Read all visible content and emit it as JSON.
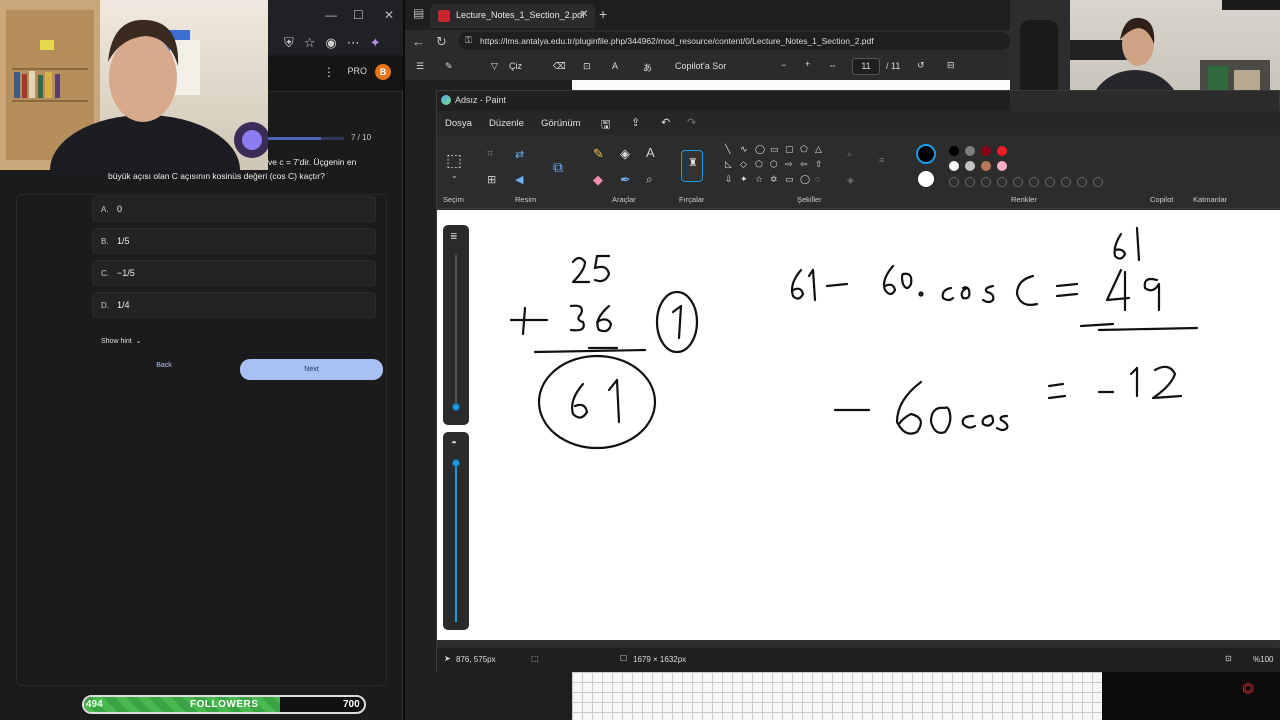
{
  "quiz": {
    "progress_text": "7 / 10",
    "progress_fraction": 0.7,
    "question_line1": "ve c = 7'dir. Üçgenin en",
    "question_line2": "büyük açısı olan C açısının kosinüs değeri (cos C) kaçtır?",
    "options": [
      {
        "letter": "A.",
        "value": "0"
      },
      {
        "letter": "B.",
        "value": "1/5"
      },
      {
        "letter": "C.",
        "value": "−1/5"
      },
      {
        "letter": "D.",
        "value": "1/4"
      }
    ],
    "show_hint": "Show hint",
    "back": "Back",
    "next": "Next",
    "pro": "PRO",
    "avatar_letter": "B"
  },
  "followers": {
    "current": "494",
    "label": "FOLLOWERS",
    "goal": "700",
    "fraction": 0.7
  },
  "pdf_browser": {
    "tab_title": "Lecture_Notes_1_Section_2.pdf",
    "url": "https://lms.antalya.edu.tr/pluginfile.php/344962/mod_resource/content/0/Lecture_Notes_1_Section_2.pdf",
    "draw_label": "Çiz",
    "copilot_label": "Copilot'a Sor",
    "page_current": "11",
    "page_total": "/ 11"
  },
  "paint": {
    "title": "Adsız - Paint",
    "menu": [
      "Dosya",
      "Düzenle",
      "Görünüm"
    ],
    "ribbon_labels": [
      "Seçim",
      "Resim",
      "Araçlar",
      "Fırçalar",
      "Şekiller",
      "Renkler",
      "Copilot",
      "Katmanlar"
    ],
    "status_cursor": "876, 575px",
    "status_size": "1679 × 1632px",
    "zoom": "%100",
    "colors": {
      "row1": [
        "#000000",
        "#7f7f7f",
        "#880015",
        "#ed1c24"
      ],
      "row2": [
        "#ffffff",
        "#c3c3c3",
        "#b97a57",
        "#ffaec9"
      ]
    }
  }
}
